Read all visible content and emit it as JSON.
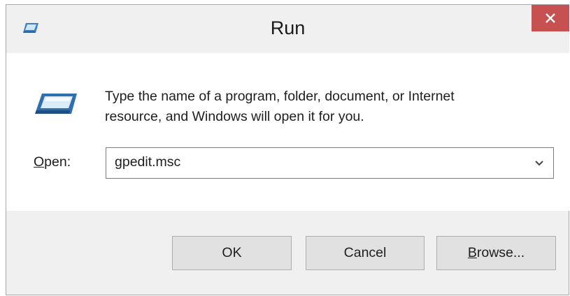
{
  "window": {
    "title": "Run",
    "close_glyph": "✕",
    "icon": "run-icon"
  },
  "description": {
    "line1": "Type the name of a program, folder, document, or Internet",
    "line2": "resource, and Windows will open it for you."
  },
  "open_field": {
    "label_access_key": "O",
    "label_rest": "pen:",
    "value": "gpedit.msc"
  },
  "buttons": {
    "ok": "OK",
    "cancel": "Cancel",
    "browse_access_key": "B",
    "browse_rest": "rowse..."
  },
  "colors": {
    "close_button": "#c75050",
    "window_background": "#f0f0f0",
    "content_background": "#ffffff",
    "button_background": "#e1e1e1"
  }
}
